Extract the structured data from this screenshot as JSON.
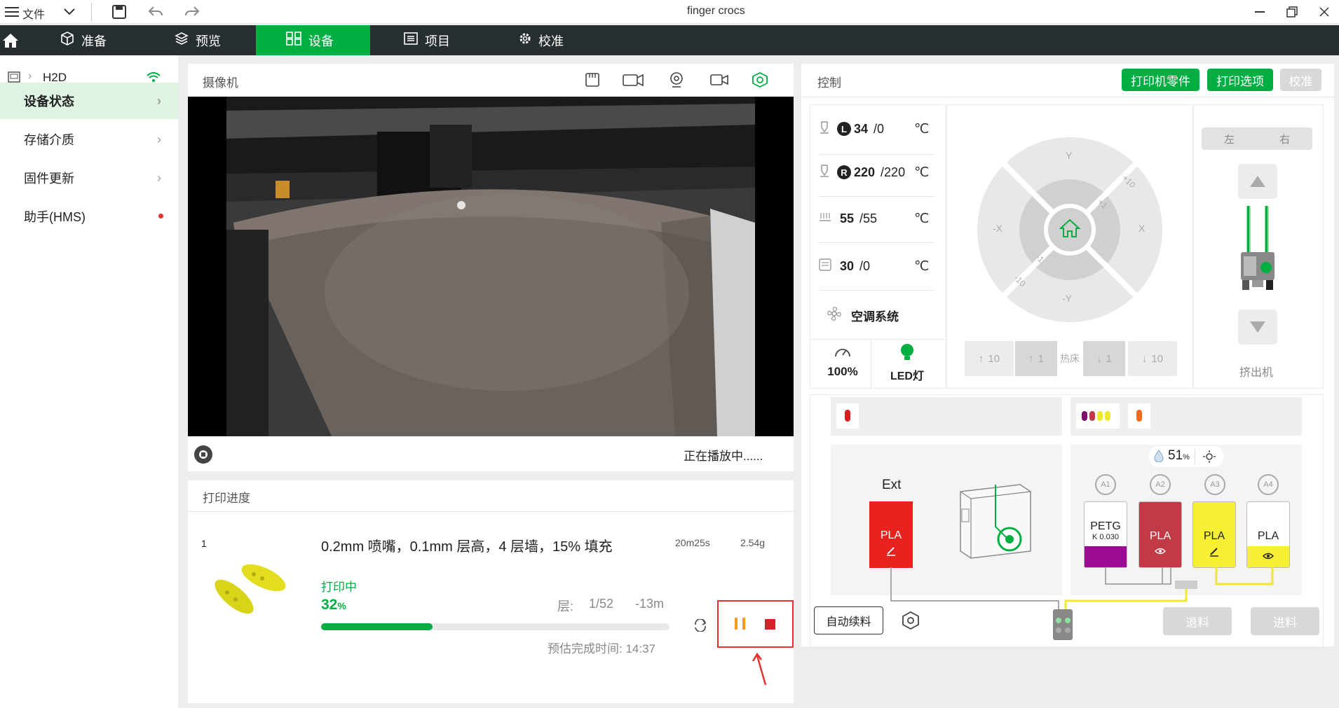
{
  "titlebar": {
    "menu_label": "文件",
    "window_title": "finger crocs"
  },
  "nav": {
    "tabs": [
      {
        "label": "准备"
      },
      {
        "label": "预览"
      },
      {
        "label": "设备"
      },
      {
        "label": "项目"
      },
      {
        "label": "校准"
      }
    ]
  },
  "sidebar": {
    "device_name": "H2D",
    "items": [
      {
        "label": "设备状态"
      },
      {
        "label": "存储介质"
      },
      {
        "label": "固件更新"
      },
      {
        "label": "助手(HMS)"
      }
    ]
  },
  "camera": {
    "title": "摄像机",
    "status": "正在播放中......"
  },
  "progress": {
    "title": "打印进度",
    "plate_index": "1",
    "job_desc": "0.2mm 喷嘴，0.1mm 层高，4 层墙，15% 填充",
    "duration": "20m25s",
    "weight": "2.54g",
    "state": "打印中",
    "percent_value": "32",
    "percent_unit": "%",
    "progress_fraction": 0.32,
    "layer_label": "层:",
    "layer_value": "1/52",
    "remaining": "-13m",
    "eta": "预估完成时间: 14:37"
  },
  "control": {
    "title": "控制",
    "btn_parts": "打印机零件",
    "btn_options": "打印选项",
    "btn_calibrate": "校准",
    "nozzle_left": {
      "badge": "L",
      "current": "34",
      "target": "/0",
      "unit": "℃"
    },
    "nozzle_right": {
      "badge": "R",
      "current": "220",
      "target": "/220",
      "unit": "℃"
    },
    "bed": {
      "current": "55",
      "target": "/55",
      "unit": "℃"
    },
    "chamber": {
      "current": "30",
      "target": "/0",
      "unit": "℃"
    },
    "ac_label": "空调系统",
    "speed_value": "100%",
    "led_label": "LED灯",
    "jog": {
      "y_pos": "Y",
      "y_neg": "-Y",
      "x_pos": "X",
      "x_neg": "-X",
      "plus10": "+10",
      "plus1": "+1",
      "minus1": "-1",
      "minus10": "-10"
    },
    "bed_buttons": [
      "10",
      "1",
      "热床",
      "1",
      "10"
    ],
    "extruder_toggle": [
      "左",
      "右"
    ],
    "extruder_label": "挤出机"
  },
  "ams": {
    "humidity_value": "51",
    "humidity_unit": "%",
    "ext_label": "Ext",
    "ext_material": "PLA",
    "slots": [
      {
        "id": "A1",
        "material": "PETG",
        "k": "K 0.030",
        "color": "#ffffff",
        "band": "#9b0b8f"
      },
      {
        "id": "A2",
        "material": "PLA",
        "k": "",
        "color": "#c13a46",
        "band": "#c13a46"
      },
      {
        "id": "A3",
        "material": "PLA",
        "k": "",
        "color": "#f7ef33",
        "band": "#f7ef33"
      },
      {
        "id": "A4",
        "material": "PLA",
        "k": "",
        "color": "#ffffff",
        "band": "#f7ef33"
      }
    ],
    "auto_refill": "自动续料",
    "unload": "退料",
    "load": "进料"
  },
  "colors": {
    "accent": "#00ae42",
    "nav_bg": "#262e30",
    "alert": "#e8312f"
  }
}
